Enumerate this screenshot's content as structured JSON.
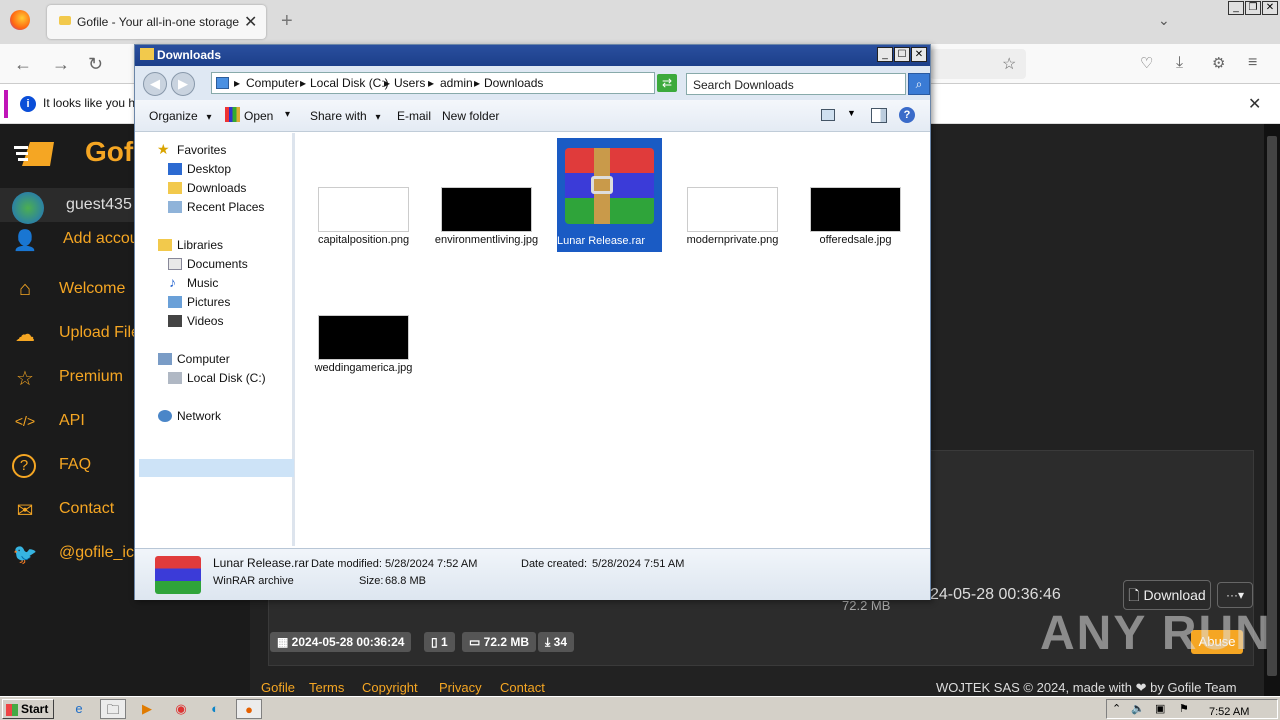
{
  "browser": {
    "tab_title": "Gofile - Your all-in-one storage solu",
    "new_tab": "+",
    "notification": "It looks like you ha",
    "close": "✕"
  },
  "gofile": {
    "brand": "Gofi",
    "username": "guest435",
    "sidebar": [
      {
        "icon": "add-user-icon",
        "glyph": "👤",
        "label": "Add accou"
      },
      {
        "icon": "home-icon",
        "glyph": "⌂",
        "label": "Welcome"
      },
      {
        "icon": "upload-icon",
        "glyph": "☁",
        "label": "Upload File"
      },
      {
        "icon": "star-icon",
        "glyph": "☆",
        "label": "Premium"
      },
      {
        "icon": "code-icon",
        "glyph": "</>",
        "label": "API"
      },
      {
        "icon": "help-icon",
        "glyph": "?",
        "label": "FAQ"
      },
      {
        "icon": "mail-icon",
        "glyph": "✉",
        "label": "Contact"
      },
      {
        "icon": "twitter-icon",
        "glyph": "🐦",
        "label": "@gofile_ic"
      }
    ],
    "file_date": "24-05-28 00:36:46",
    "file_size": "72.2 MB",
    "download_label": "Download",
    "more_label": "···▾",
    "pills": {
      "date": "2024-05-28 00:36:24",
      "files": "1",
      "size": "72.2 MB",
      "downloads": "34"
    },
    "abuse_label": "Abuse",
    "footer_links": [
      "Gofile",
      "Terms",
      "Copyright",
      "Privacy",
      "Contact"
    ],
    "footer_right": "WOJTEK SAS © 2024, made with ❤ by Gofile Team"
  },
  "explorer": {
    "title": "Downloads",
    "breadcrumb": [
      "Computer",
      "Local Disk (C:)",
      "Users",
      "admin",
      "Downloads"
    ],
    "search_placeholder": "Search Downloads",
    "commands": {
      "organize": "Organize",
      "open": "Open",
      "share": "Share with",
      "email": "E-mail",
      "newfolder": "New folder"
    },
    "nav": {
      "favorites": "Favorites",
      "desktop": "Desktop",
      "downloads": "Downloads",
      "recent": "Recent Places",
      "libraries": "Libraries",
      "documents": "Documents",
      "music": "Music",
      "pictures": "Pictures",
      "videos": "Videos",
      "computer": "Computer",
      "localdisk": "Local Disk (C:)",
      "network": "Network"
    },
    "files": [
      {
        "name": "capitalposition.png",
        "thumb": "light"
      },
      {
        "name": "environmentliving.jpg",
        "thumb": "dark"
      },
      {
        "name": "Lunar Release.rar",
        "thumb": "rar"
      },
      {
        "name": "modernprivate.png",
        "thumb": "light"
      },
      {
        "name": "offeredsale.jpg",
        "thumb": "dark"
      },
      {
        "name": "weddingamerica.jpg",
        "thumb": "dark"
      }
    ],
    "status": {
      "name": "Lunar Release.rar",
      "type": "WinRAR archive",
      "modified_label": "Date modified:",
      "modified": "5/28/2024 7:52 AM",
      "created_label": "Date created:",
      "created": "5/28/2024 7:51 AM",
      "size_label": "Size:",
      "size": "68.8 MB"
    }
  },
  "taskbar": {
    "start": "Start",
    "clock": "7:52 AM"
  },
  "watermark": "ANY RUN"
}
